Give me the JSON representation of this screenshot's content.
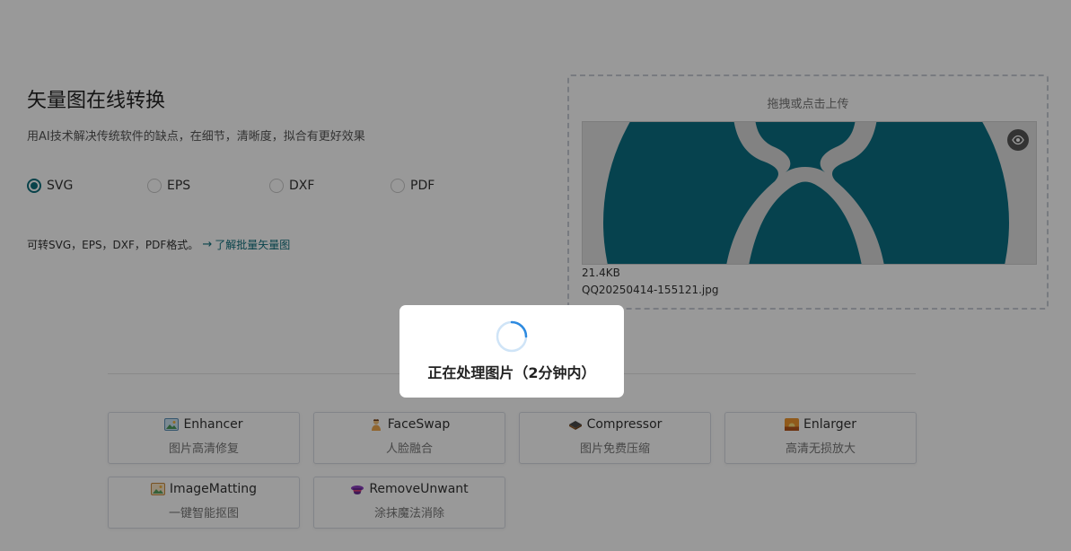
{
  "header": {
    "title": "矢量图在线转换",
    "subtitle": "用AI技术解决传统软件的缺点，在细节，清晰度，拟合有更好效果"
  },
  "formats": {
    "options": [
      {
        "label": "SVG",
        "checked": true
      },
      {
        "label": "EPS",
        "checked": false
      },
      {
        "label": "DXF",
        "checked": false
      },
      {
        "label": "PDF",
        "checked": false
      }
    ]
  },
  "hint": {
    "text": "可转SVG，EPS，DXF，PDF格式。",
    "link": "了解批量矢量图"
  },
  "upload": {
    "label": "拖拽或点击上传",
    "file_size": "21.4KB",
    "file_name": "QQ20250414-155121.jpg"
  },
  "tools": [
    {
      "name": "Enhancer",
      "desc": "图片高清修复",
      "icon": "picture-icon"
    },
    {
      "name": "FaceSwap",
      "desc": "人脸融合",
      "icon": "person-icon"
    },
    {
      "name": "Compressor",
      "desc": "图片免费压缩",
      "icon": "stack-icon"
    },
    {
      "name": "Enlarger",
      "desc": "高清无损放大",
      "icon": "sunset-icon"
    },
    {
      "name": "ImageMatting",
      "desc": "一键智能抠图",
      "icon": "picture-icon"
    },
    {
      "name": "RemoveUnwant",
      "desc": "涂抹魔法消除",
      "icon": "magic-hat-icon"
    }
  ],
  "modal": {
    "text": "正在处理图片（2分钟内）"
  },
  "colors": {
    "accent": "#0e6f7c",
    "preview_blue": "#0a6f83",
    "overlay": "rgba(0,0,0,0.4)"
  }
}
